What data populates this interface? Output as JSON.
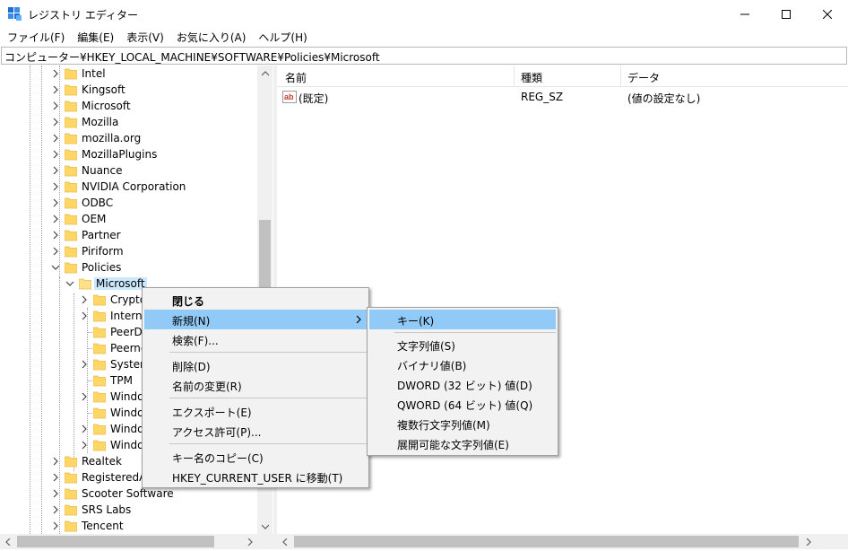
{
  "window": {
    "title": "レジストリ エディター",
    "controls": {
      "minimize": "—",
      "maximize": "☐",
      "close": "✕"
    }
  },
  "menubar": {
    "items": [
      {
        "label": "ファイル(F)"
      },
      {
        "label": "編集(E)"
      },
      {
        "label": "表示(V)"
      },
      {
        "label": "お気に入り(A)"
      },
      {
        "label": "ヘルプ(H)"
      }
    ]
  },
  "address": {
    "value": "コンピューター¥HKEY_LOCAL_MACHINE¥SOFTWARE¥Policies¥Microsoft"
  },
  "tree": {
    "items": [
      {
        "label": "Intel"
      },
      {
        "label": "Kingsoft"
      },
      {
        "label": "Microsoft"
      },
      {
        "label": "Mozilla"
      },
      {
        "label": "mozilla.org"
      },
      {
        "label": "MozillaPlugins"
      },
      {
        "label": "Nuance"
      },
      {
        "label": "NVIDIA Corporation"
      },
      {
        "label": "ODBC"
      },
      {
        "label": "OEM"
      },
      {
        "label": "Partner"
      },
      {
        "label": "Piriform"
      },
      {
        "label": "Policies"
      },
      {
        "label": "Microsoft"
      },
      {
        "label": "Crypto"
      },
      {
        "label": "Interne"
      },
      {
        "label": "PeerDi"
      },
      {
        "label": "Peerne"
      },
      {
        "label": "System"
      },
      {
        "label": "TPM"
      },
      {
        "label": "Windo"
      },
      {
        "label": "Windo"
      },
      {
        "label": "Windo"
      },
      {
        "label": "Windo"
      },
      {
        "label": "Realtek"
      },
      {
        "label": "RegisteredAp"
      },
      {
        "label": "Scooter Software"
      },
      {
        "label": "SRS Labs"
      },
      {
        "label": "Tencent"
      }
    ]
  },
  "list": {
    "columns": {
      "name": "名前",
      "type": "種類",
      "data": "データ"
    },
    "rows": [
      {
        "name": "(既定)",
        "type": "REG_SZ",
        "data": "(値の設定なし)"
      }
    ]
  },
  "context_menu": {
    "items": [
      {
        "label": "閉じる"
      },
      {
        "label": "新規(N)"
      },
      {
        "label": "検索(F)..."
      },
      {
        "label": "削除(D)"
      },
      {
        "label": "名前の変更(R)"
      },
      {
        "label": "エクスポート(E)"
      },
      {
        "label": "アクセス許可(P)..."
      },
      {
        "label": "キー名のコピー(C)"
      },
      {
        "label": "HKEY_CURRENT_USER に移動(T)"
      }
    ]
  },
  "submenu": {
    "items": [
      {
        "label": "キー(K)"
      },
      {
        "label": "文字列値(S)"
      },
      {
        "label": "バイナリ値(B)"
      },
      {
        "label": "DWORD (32 ビット) 値(D)"
      },
      {
        "label": "QWORD (64 ビット) 値(Q)"
      },
      {
        "label": "複数行文字列値(M)"
      },
      {
        "label": "展開可能な文字列値(E)"
      }
    ]
  },
  "colors": {
    "highlight": "#91c9f7",
    "selection": "#cce8ff",
    "folder": "#ffd766",
    "folder_dark": "#e8b94a"
  }
}
